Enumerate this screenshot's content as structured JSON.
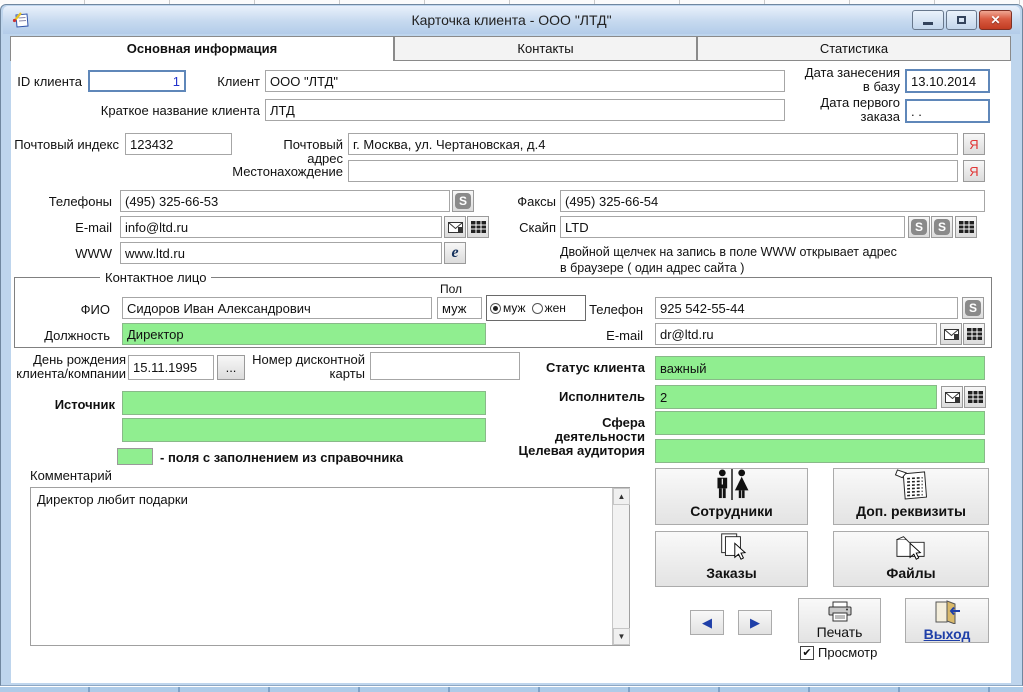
{
  "window": {
    "title": "Карточка клиента  -  ООО \"ЛТД\""
  },
  "icons": {
    "yandex": "Я",
    "skype": "S",
    "browser": "e",
    "check": "✔",
    "prev": "◀",
    "next": "▶",
    "scroll_up": "▲",
    "scroll_down": "▼",
    "dots": "...",
    "close": "✕"
  },
  "tabs": [
    {
      "label": "Основная информация"
    },
    {
      "label": "Контакты"
    },
    {
      "label": "Статистика"
    }
  ],
  "main": {
    "client_id": {
      "label": "ID клиента",
      "value": "1"
    },
    "client": {
      "label": "Клиент",
      "value": "ООО \"ЛТД\""
    },
    "date_added": {
      "label": "Дата занесения в базу",
      "value": "13.10.2014"
    },
    "short_name": {
      "label": "Краткое название клиента",
      "value": "ЛТД"
    },
    "first_order_date": {
      "label": "Дата первого заказа",
      "value": ". ."
    },
    "postal_code": {
      "label": "Почтовый индекс",
      "value": "123432"
    },
    "postal_address": {
      "label": "Почтовый адрес",
      "value": "г. Москва, ул. Чертановская, д.4"
    },
    "location": {
      "label": "Местонахождение",
      "value": ""
    },
    "phones": {
      "label": "Телефоны",
      "value": "(495) 325-66-53"
    },
    "faxes": {
      "label": "Факсы",
      "value": "(495) 325-66-54"
    },
    "email": {
      "label": "E-mail",
      "value": "info@ltd.ru"
    },
    "skype": {
      "label": "Скайп",
      "value": "LTD"
    },
    "www": {
      "label": "WWW",
      "value": "www.ltd.ru"
    },
    "www_hint_line1": "Двойной щелчек на запись в поле WWW открывает адрес",
    "www_hint_line2": "в браузере ( один адрес сайта )"
  },
  "contact_person": {
    "group_title": "Контактное лицо",
    "fio": {
      "label": "ФИО",
      "value": "Сидоров Иван Александрович"
    },
    "gender": {
      "label": "Пол",
      "value": "муж",
      "options": [
        "муж",
        "жен"
      ],
      "selected": "муж"
    },
    "phone": {
      "label": "Телефон",
      "value": "925 542-55-44"
    },
    "position": {
      "label": "Должность",
      "value": "Директор"
    },
    "email": {
      "label": "E-mail",
      "value": "dr@ltd.ru"
    }
  },
  "details": {
    "birthday": {
      "label": "День рождения клиента/компании",
      "value": "15.11.1995"
    },
    "discount_card": {
      "label": "Номер дисконтной карты",
      "value": ""
    },
    "status": {
      "label": "Статус клиента",
      "value": "важный"
    },
    "executor": {
      "label": "Исполнитель",
      "value": "2"
    },
    "source": {
      "label": "Источник",
      "value1": "",
      "value2": ""
    },
    "sphere": {
      "label": "Сфера деятельности",
      "value": ""
    },
    "audience": {
      "label": "Целевая аудитория",
      "value": ""
    },
    "legend": "- поля с заполнением из справочника"
  },
  "comment": {
    "label": "Комментарий",
    "value": "Директор любит подарки"
  },
  "actions": {
    "employees": "Сотрудники",
    "requisites": "Доп. реквизиты",
    "orders": "Заказы",
    "files": "Файлы",
    "print": "Печать",
    "preview": "Просмотр",
    "preview_checked": true,
    "exit": "Выход"
  },
  "colors": {
    "reference_field": "#90ee90",
    "accent_blue": "#1f3fa8",
    "yandex_red": "#e03535"
  }
}
